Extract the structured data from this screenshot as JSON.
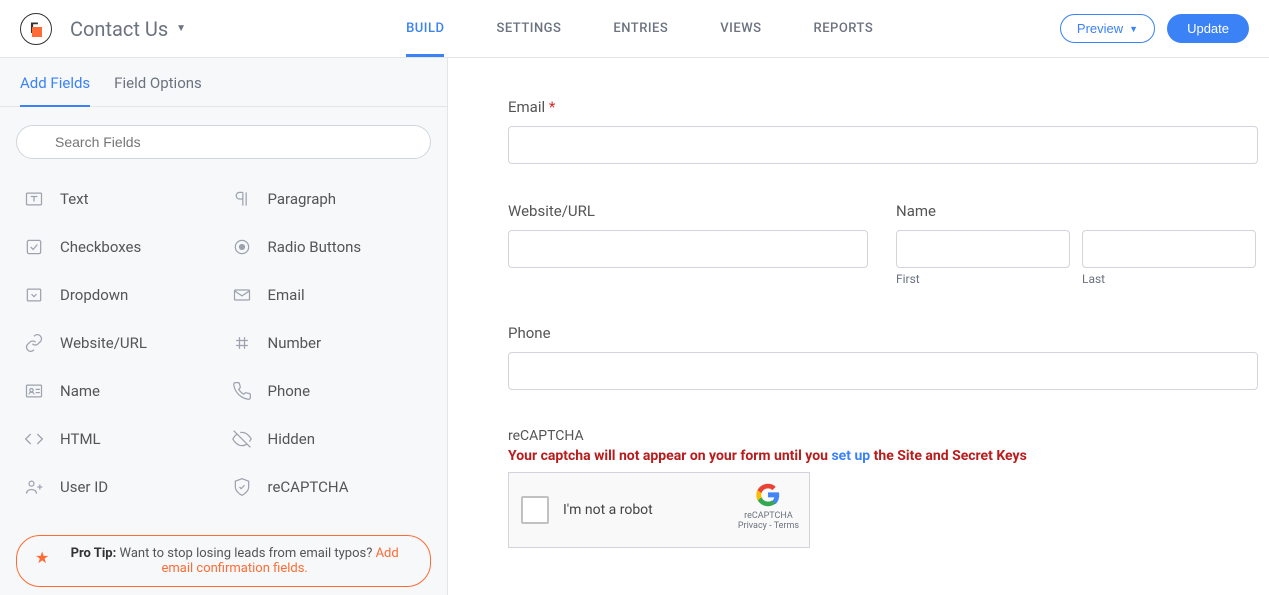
{
  "header": {
    "form_title": "Contact Us",
    "nav": [
      "BUILD",
      "SETTINGS",
      "ENTRIES",
      "VIEWS",
      "REPORTS"
    ],
    "nav_active": 0,
    "preview": "Preview",
    "update": "Update"
  },
  "sidebar": {
    "tabs": [
      "Add Fields",
      "Field Options"
    ],
    "tabs_active": 0,
    "search_placeholder": "Search Fields",
    "fields": [
      {
        "icon": "text",
        "label": "Text"
      },
      {
        "icon": "paragraph",
        "label": "Paragraph"
      },
      {
        "icon": "check",
        "label": "Checkboxes"
      },
      {
        "icon": "radio",
        "label": "Radio Buttons"
      },
      {
        "icon": "dropdown",
        "label": "Dropdown"
      },
      {
        "icon": "mail",
        "label": "Email"
      },
      {
        "icon": "link",
        "label": "Website/URL"
      },
      {
        "icon": "hash",
        "label": "Number"
      },
      {
        "icon": "name",
        "label": "Name"
      },
      {
        "icon": "phone",
        "label": "Phone"
      },
      {
        "icon": "html",
        "label": "HTML"
      },
      {
        "icon": "hidden",
        "label": "Hidden"
      },
      {
        "icon": "user",
        "label": "User ID"
      },
      {
        "icon": "shield",
        "label": "reCAPTCHA"
      }
    ],
    "pro_tip_label": "Pro Tip:",
    "pro_tip_text": " Want to stop losing leads from email typos? ",
    "pro_tip_link": "Add email confirmation fields."
  },
  "form": {
    "email_label": "Email",
    "website_label": "Website/URL",
    "name_label": "Name",
    "name_first": "First",
    "name_last": "Last",
    "phone_label": "Phone",
    "recaptcha_label": "reCAPTCHA",
    "recaptcha_warn_a": "Your captcha will not appear on your form until you ",
    "recaptcha_warn_link": "set up",
    "recaptcha_warn_b": " the Site and Secret Keys",
    "recaptcha_text": "I'm not a robot",
    "recaptcha_brand": "reCAPTCHA",
    "recaptcha_privacy": "Privacy - Terms"
  }
}
